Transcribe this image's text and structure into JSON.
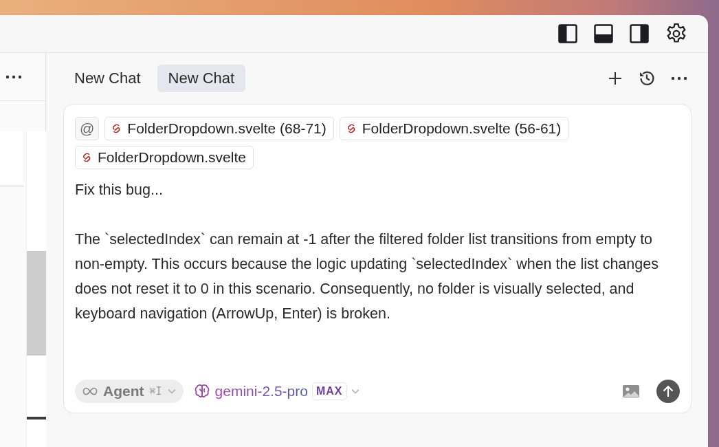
{
  "tabs": [
    {
      "label": "New Chat",
      "selected": false
    },
    {
      "label": "New Chat",
      "selected": true
    }
  ],
  "context_chips": [
    {
      "kind": "mention",
      "label": "@"
    },
    {
      "kind": "file",
      "label": "FolderDropdown.svelte (68-71)"
    },
    {
      "kind": "file",
      "label": "FolderDropdown.svelte (56-61)"
    },
    {
      "kind": "file",
      "label": "FolderDropdown.svelte"
    }
  ],
  "message": [
    "Fix this bug...",
    "The `selectedIndex` can remain at -1 after the filtered folder list transitions from empty to non-empty. This occurs because the logic updating `selectedIndex` when the list changes does not reset it to 0 in this scenario. Consequently, no folder is visually selected, and keyboard navigation (ArrowUp, Enter) is broken."
  ],
  "mode": {
    "label": "Agent",
    "shortcut": "⌘I"
  },
  "model": {
    "name": "gemini-2.5-pro",
    "badge": "MAX"
  }
}
